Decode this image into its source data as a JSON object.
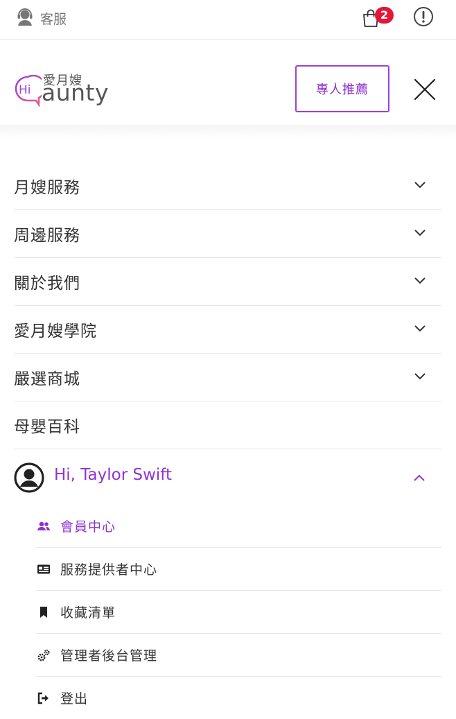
{
  "topbar": {
    "customer_service_label": "客服",
    "cart_count": "2",
    "icons": [
      "headset-icon",
      "shopping-bag-icon",
      "info-circle-icon"
    ]
  },
  "header": {
    "logo": {
      "bubble_text": "Hi",
      "chinese_name": "愛月嫂",
      "english_name": "aunty"
    },
    "recommend_button": "專人推薦",
    "close_icon": "close-icon"
  },
  "menu": {
    "items": [
      {
        "label": "月嫂服務",
        "expandable": true
      },
      {
        "label": "周邊服務",
        "expandable": true
      },
      {
        "label": "關於我們",
        "expandable": true
      },
      {
        "label": "愛月嫂學院",
        "expandable": true
      },
      {
        "label": "嚴選商城",
        "expandable": true
      },
      {
        "label": "母嬰百科",
        "expandable": false
      }
    ]
  },
  "user": {
    "greeting": "Hi, Taylor Swift",
    "expanded": true,
    "submenu": [
      {
        "label": "會員中心",
        "icon": "users-icon",
        "active": true
      },
      {
        "label": "服務提供者中心",
        "icon": "id-card-icon",
        "active": false
      },
      {
        "label": "收藏清單",
        "icon": "bookmark-icon",
        "active": false
      },
      {
        "label": "管理者後台管理",
        "icon": "gears-icon",
        "active": false
      },
      {
        "label": "登出",
        "icon": "sign-out-icon",
        "active": false
      }
    ]
  },
  "colors": {
    "accent_purple": "#8d33cf",
    "badge_red": "#e5163a",
    "text_dark": "#333333",
    "divider": "#e6e6e6"
  }
}
